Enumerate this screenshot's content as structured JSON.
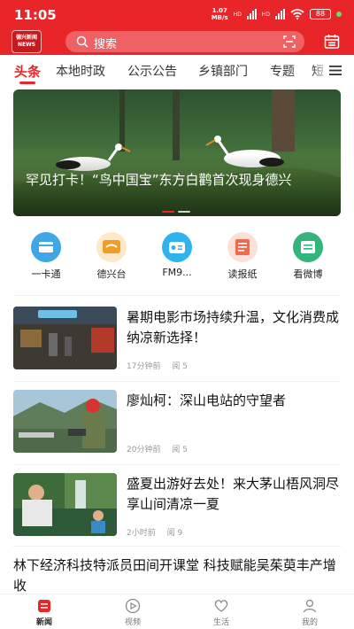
{
  "status_bar": {
    "time": "11:05",
    "net_speed_value": "1.07",
    "net_speed_unit": "MB/s",
    "network_1": "HD",
    "network_2": "HD",
    "battery": "88"
  },
  "header": {
    "logo_line1": "德兴新闻",
    "logo_line2": "NEWS",
    "search_placeholder": "搜索"
  },
  "tabs": [
    {
      "label": "头条",
      "active": true
    },
    {
      "label": "本地时政"
    },
    {
      "label": "公示公告"
    },
    {
      "label": "乡镇部门"
    },
    {
      "label": "专题"
    },
    {
      "label": "短"
    }
  ],
  "banner": {
    "title": "罕见打卡！“鸟中国宝”东方白鹳首次现身德兴",
    "slide_count": 2,
    "current_slide": 1
  },
  "quick_links": [
    {
      "label": "一卡通",
      "icon": "card-icon",
      "color": "#3fa7e6"
    },
    {
      "label": "德兴台",
      "icon": "tv-station-icon",
      "color": "#f29b26"
    },
    {
      "label": "FM9...",
      "icon": "radio-icon",
      "color": "#2fb3ec"
    },
    {
      "label": "读报纸",
      "icon": "newspaper-icon",
      "color": "#f06a4e"
    },
    {
      "label": "看微博",
      "icon": "weibo-icon",
      "color": "#33b47a"
    }
  ],
  "news": [
    {
      "title": "暑期电影市场持续升温，文化消费成纳凉新选择！",
      "time": "17分钟前",
      "views": "阅 5"
    },
    {
      "title": "廖灿柯：深山电站的守望者",
      "time": "20分钟前",
      "views": "阅 5"
    },
    {
      "title": "盛夏出游好去处！来大茅山梧风洞尽享山间清凉一夏",
      "time": "2小时前",
      "views": "阅 9"
    }
  ],
  "text_news": {
    "title": "林下经济科技特派员田间开课堂 科技赋能吴茱萸丰产增收"
  },
  "bottom_nav": [
    {
      "label": "新闻",
      "icon": "news-icon",
      "active": true
    },
    {
      "label": "视频",
      "icon": "video-icon"
    },
    {
      "label": "生活",
      "icon": "life-heart-icon"
    },
    {
      "label": "我的",
      "icon": "profile-icon"
    }
  ],
  "colors": {
    "brand_red": "#e8262a",
    "meta_gray": "#999999"
  }
}
